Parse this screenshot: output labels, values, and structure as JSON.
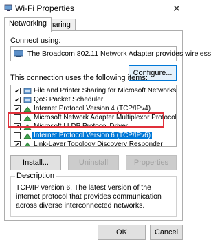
{
  "window": {
    "title": "Wi-Fi Properties",
    "close_glyph": "✕"
  },
  "tabs": [
    {
      "label": "Networking",
      "active": true
    },
    {
      "label": "Sharing",
      "active": false
    }
  ],
  "connect_using": {
    "label": "Connect using:",
    "adapter": "The Broadcom 802.11 Network Adapter provides wireless",
    "configure_button": "Configure..."
  },
  "items_label": "This connection uses the following items:",
  "items": [
    {
      "label": "File and Printer Sharing for Microsoft Networks",
      "checked": true,
      "icon": "service-icon"
    },
    {
      "label": "QoS Packet Scheduler",
      "checked": true,
      "icon": "service-icon"
    },
    {
      "label": "Internet Protocol Version 4 (TCP/IPv4)",
      "checked": true,
      "icon": "protocol-icon"
    },
    {
      "label": "Microsoft Network Adapter Multiplexor Protocol",
      "checked": false,
      "icon": "protocol-icon"
    },
    {
      "label": "Microsoft LLDP Protocol Driver",
      "checked": false,
      "icon": "protocol-icon"
    },
    {
      "label": "Internet Protocol Version 6 (TCP/IPv6)",
      "checked": false,
      "icon": "protocol-icon",
      "selected": true
    },
    {
      "label": "Link-Layer Topology Discovery Responder",
      "checked": false,
      "icon": "protocol-icon"
    }
  ],
  "buttons": {
    "install": "Install...",
    "uninstall": "Uninstall",
    "properties": "Properties",
    "ok": "OK",
    "cancel": "Cancel"
  },
  "description": {
    "legend": "Description",
    "text": "TCP/IP version 6. The latest version of the internet protocol that provides communication across diverse interconnected networks."
  },
  "colors": {
    "accent": "#0078d7",
    "highlight_box": "#e0303a"
  }
}
